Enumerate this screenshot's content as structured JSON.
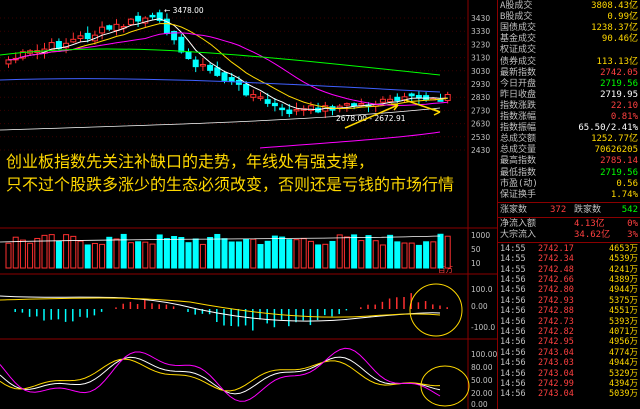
{
  "captions": {
    "line1": "创业板指数先关注补缺口的走势，年线处有强支撑，",
    "line2": "只不过个股跌多涨少的生态必须改变，否则还是亏钱的市场行情"
  },
  "price_chart": {
    "high_label": "3478.00",
    "low_label": "2678.00 - 2672.91",
    "y_ticks": [
      "3430",
      "3330",
      "3230",
      "3130",
      "3030",
      "2930",
      "2830",
      "2730",
      "2630",
      "2530",
      "2430"
    ]
  },
  "volume_panel": {
    "y_ticks": [
      "1000",
      "50",
      "10"
    ],
    "unit_label": "百万"
  },
  "macd_panel": {
    "y_ticks": [
      "100.0",
      "0.00",
      "-100.0"
    ]
  },
  "kdj_panel": {
    "y_ticks": [
      "100.00",
      "80.00",
      "50.00",
      "20.00",
      "0.00"
    ]
  },
  "quote_panel": {
    "rows": [
      {
        "label": "A股成交",
        "value": "3808.43亿",
        "color": "#ffd800"
      },
      {
        "label": "B股成交",
        "value": "0.99亿",
        "color": "#ffd800"
      },
      {
        "label": "国债成交",
        "value": "1238.37亿",
        "color": "#ffd800"
      },
      {
        "label": "基金成交",
        "value": "90.46亿",
        "color": "#ffd800"
      },
      {
        "label": "权证成交",
        "value": "",
        "color": "#ffd800"
      },
      {
        "label": "债券成交",
        "value": "113.13亿",
        "color": "#ffd800"
      },
      {
        "label": "最新指数",
        "value": "2742.05",
        "color": "#ff4040"
      },
      {
        "label": "今日开盘",
        "value": "2719.56",
        "color": "#00ff00"
      },
      {
        "label": "昨日收盘",
        "value": "2719.95",
        "color": "#ffffff"
      },
      {
        "label": "指数涨跌",
        "value": "22.10",
        "color": "#ff4040"
      },
      {
        "label": "指数涨幅",
        "value": "0.81%",
        "color": "#ff4040"
      },
      {
        "label": "指数振幅",
        "value": "65.50/2.41%",
        "color": "#ffffff"
      },
      {
        "label": "总成交额",
        "value": "1252.77亿",
        "color": "#ffd800"
      },
      {
        "label": "总成交量",
        "value": "70626205",
        "color": "#ffd800"
      },
      {
        "label": "最高指数",
        "value": "2785.14",
        "color": "#ff4040"
      },
      {
        "label": "最低指数",
        "value": "2719.56",
        "color": "#00ff00"
      },
      {
        "label": "市盈(动)",
        "value": "0.56",
        "color": "#ffd800"
      },
      {
        "label": "保证换手",
        "value": "1.74%",
        "color": "#ffd800"
      }
    ],
    "breadth": {
      "up_label": "涨家数",
      "up_value": "372",
      "down_label": "跌家数",
      "down_value": "542"
    },
    "flows": [
      {
        "label": "净流入额",
        "value": "4.13亿",
        "pct": "0%"
      },
      {
        "label": "大宗流入",
        "value": "34.62亿",
        "pct": "3%"
      }
    ],
    "ticks": [
      {
        "time": "14:55",
        "price": "2742.17",
        "vol": "4653万"
      },
      {
        "time": "14:55",
        "price": "2742.34",
        "vol": "4539万"
      },
      {
        "time": "14:55",
        "price": "2742.48",
        "vol": "4241万"
      },
      {
        "time": "14:56",
        "price": "2742.66",
        "vol": "4389万"
      },
      {
        "time": "14:56",
        "price": "2742.80",
        "vol": "4944万"
      },
      {
        "time": "14:56",
        "price": "2742.93",
        "vol": "5375万"
      },
      {
        "time": "14:56",
        "price": "2742.88",
        "vol": "4551万"
      },
      {
        "time": "14:56",
        "price": "2742.73",
        "vol": "5393万"
      },
      {
        "time": "14:56",
        "price": "2742.82",
        "vol": "4071万"
      },
      {
        "time": "14:56",
        "price": "2742.95",
        "vol": "4956万"
      },
      {
        "time": "14:56",
        "price": "2743.04",
        "vol": "4774万"
      },
      {
        "time": "14:56",
        "price": "2743.03",
        "vol": "4944万"
      },
      {
        "time": "14:56",
        "price": "2743.04",
        "vol": "5329万"
      },
      {
        "time": "14:56",
        "price": "2742.99",
        "vol": "4394万"
      },
      {
        "time": "14:56",
        "price": "2743.04",
        "vol": "5039万"
      }
    ]
  },
  "colors": {
    "up": "#ff3030",
    "down": "#00ffff",
    "ma5": "#ffffff",
    "ma10": "#ffd800",
    "ma20": "#ff00ff",
    "ma60": "#00ff00",
    "ma120": "#4060ff",
    "annual": "#ff00ff",
    "caption": "#ffd800"
  }
}
